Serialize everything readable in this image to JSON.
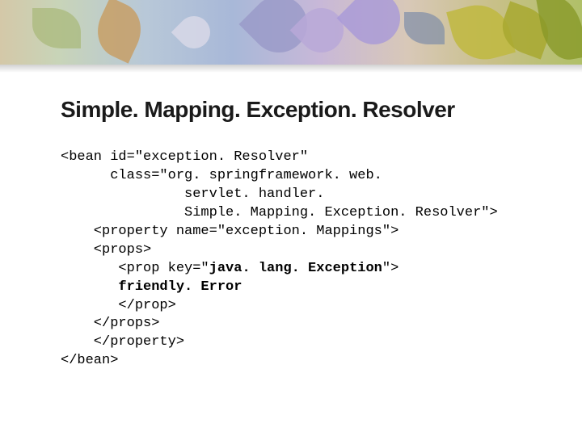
{
  "title": "Simple. Mapping. Exception. Resolver",
  "code": {
    "l01": "<bean id=\"exception. Resolver\"",
    "l02": "      class=\"org. springframework. web.",
    "l03": "               servlet. handler.",
    "l04": "               Simple. Mapping. Exception. Resolver\">",
    "l05": "    <property name=\"exception. Mappings\">",
    "l06": "    <props>",
    "l07a": "       <prop key=\"",
    "l07b": "java. lang. Exception",
    "l07c": "\">",
    "l08": "       friendly. Error",
    "l09": "       </prop>",
    "l10": "    </props>",
    "l11": "    </property>",
    "l12": "</bean>"
  }
}
